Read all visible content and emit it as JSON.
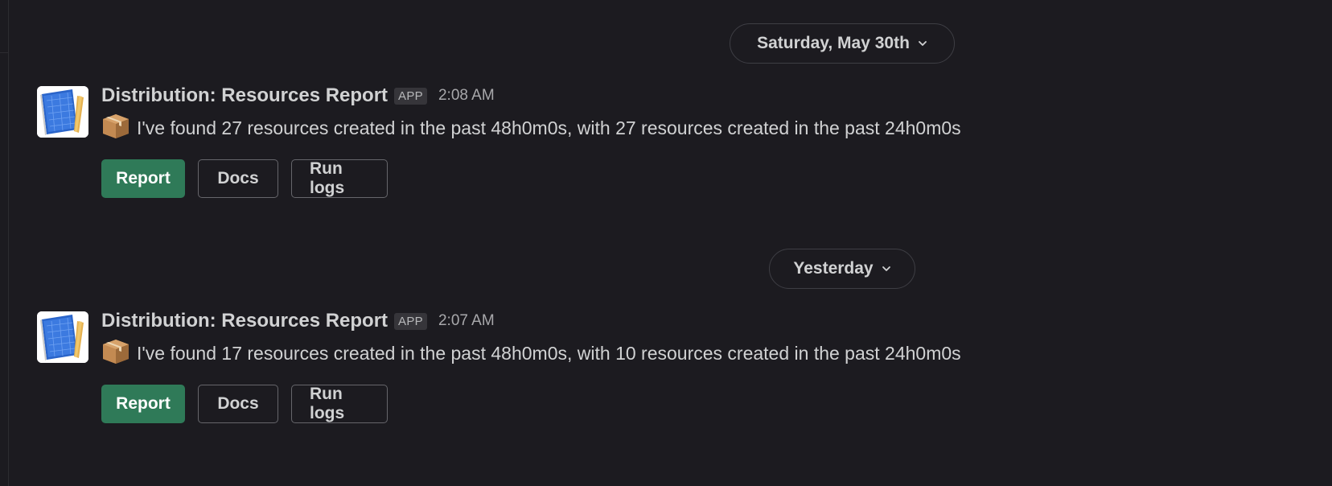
{
  "date_dividers": [
    {
      "label": "Saturday, May 30th"
    },
    {
      "label": "Yesterday"
    }
  ],
  "messages": [
    {
      "sender": "Distribution: Resources Report",
      "badge": "APP",
      "time": "2:08 AM",
      "text": "I've found 27 resources created in the past 48h0m0s, with 27 resources created in the past 24h0m0s",
      "buttons": {
        "report": "Report",
        "docs": "Docs",
        "logs": "Run logs"
      }
    },
    {
      "sender": "Distribution: Resources Report",
      "badge": "APP",
      "time": "2:07 AM",
      "text": "I've found 17 resources created in the past 48h0m0s, with 10 resources created in the past 24h0m0s",
      "buttons": {
        "report": "Report",
        "docs": "Docs",
        "logs": "Run logs"
      }
    }
  ],
  "icons": {
    "avatar": "blueprint-notebook-icon",
    "message_prefix": "package-icon",
    "date_toggle": "chevron-down-icon"
  },
  "colors": {
    "background": "#1c1b20",
    "primary_button": "#2f7a58",
    "text": "#d1d2d3"
  }
}
